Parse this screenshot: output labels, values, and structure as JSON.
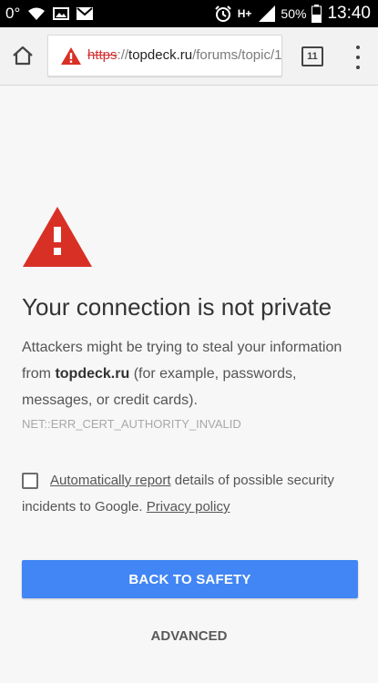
{
  "statusbar": {
    "temp": "0°",
    "battery_pct": "50%",
    "time": "13:40",
    "network": "H+",
    "icons": [
      "wifi-icon",
      "image-icon",
      "mail-icon",
      "alarm-icon",
      "signal-icon",
      "battery-icon"
    ]
  },
  "toolbar": {
    "url_scheme": "https",
    "url_sep": "://",
    "url_host": "topdeck.ru",
    "url_path": "/forums/topic/1",
    "tab_count": "11",
    "icons": [
      "home-icon",
      "warning-icon",
      "menu-icon"
    ]
  },
  "interstitial": {
    "heading": "Your connection is not private",
    "para_prefix": "Attackers might be trying to steal your information from ",
    "para_host": "topdeck.ru",
    "para_suffix": " (for example, passwords, messages, or credit cards).",
    "error_code": "NET::ERR_CERT_AUTHORITY_INVALID",
    "report_link": "Automatically report",
    "report_middle": " details of possible security incidents to Google. ",
    "privacy_link": "Privacy policy",
    "back_button": "BACK TO SAFETY",
    "advanced_button": "ADVANCED"
  },
  "colors": {
    "warning_red": "#d93025",
    "primary_blue": "#4285f4",
    "scheme_red": "#d32f2f"
  }
}
